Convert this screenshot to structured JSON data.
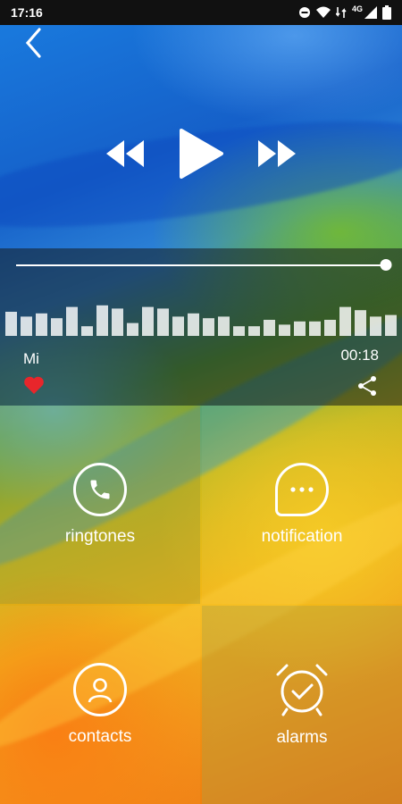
{
  "status_bar": {
    "time": "17:16",
    "icons": [
      "do-not-disturb-icon",
      "wifi-icon",
      "data-transfer-icon",
      "4g-signal-icon",
      "battery-icon"
    ],
    "network_label": "4G"
  },
  "player": {
    "progress": 0.996,
    "song_title": "Mi",
    "elapsed": "00:18",
    "favorite": true,
    "waveform_levels": [
      0.75,
      0.6,
      0.7,
      0.55,
      0.9,
      0.3,
      0.95,
      0.85,
      0.4,
      0.9,
      0.85,
      0.6,
      0.7,
      0.55,
      0.6,
      0.3,
      0.3,
      0.5,
      0.35,
      0.45,
      0.45,
      0.5,
      0.9,
      0.8,
      0.6,
      0.65
    ]
  },
  "grid": {
    "ringtones": "ringtones",
    "notification": "notification",
    "contacts": "contacts",
    "alarms": "alarms"
  },
  "colors": {
    "accent_heart": "#e8262b",
    "text": "#ffffff"
  }
}
